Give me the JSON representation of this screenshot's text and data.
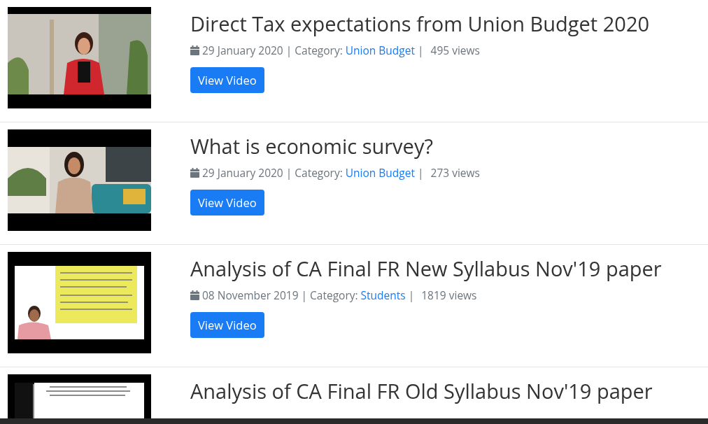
{
  "videos": [
    {
      "title": "Direct Tax expectations from Union Budget 2020",
      "date": "29 January 2020",
      "separator": "|",
      "category_label": "Category:",
      "category": "Union Budget",
      "views": "495 views",
      "button": "View Video"
    },
    {
      "title": "What is economic survey?",
      "date": "29 January 2020",
      "separator": "|",
      "category_label": "Category:",
      "category": "Union Budget",
      "views": "273 views",
      "button": "View Video"
    },
    {
      "title": "Analysis of CA Final FR New Syllabus Nov'19 paper",
      "date": "08 November 2019",
      "separator": "|",
      "category_label": "Category:",
      "category": "Students",
      "views": "1819 views",
      "button": "View Video"
    },
    {
      "title": "Analysis of CA Final FR Old Syllabus Nov'19 paper"
    }
  ]
}
